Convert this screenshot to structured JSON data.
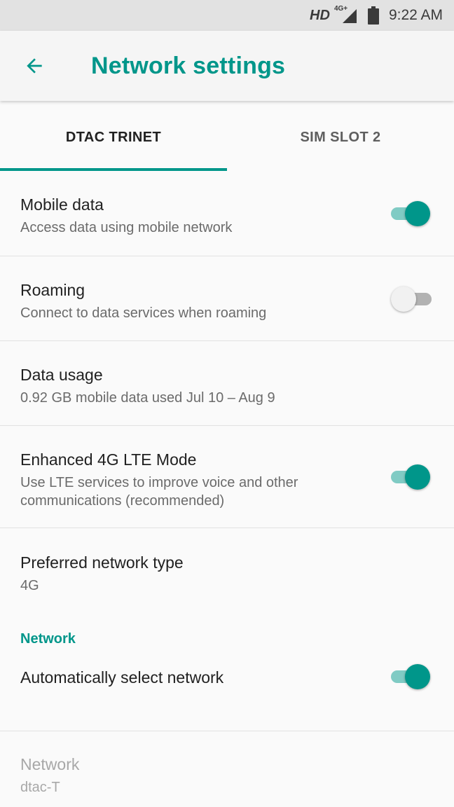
{
  "status_bar": {
    "hd": "HD",
    "network": "4G+",
    "time": "9:22 AM",
    "icons": [
      "signal-icon",
      "battery-icon"
    ]
  },
  "app_bar": {
    "title": "Network settings",
    "back_icon": "arrow-back-icon"
  },
  "tabs": [
    {
      "label": "DTAC TRINET",
      "active": true
    },
    {
      "label": "SIM SLOT 2",
      "active": false
    }
  ],
  "settings": {
    "mobile_data": {
      "title": "Mobile data",
      "summary": "Access data using mobile network",
      "enabled": true
    },
    "roaming": {
      "title": "Roaming",
      "summary": "Connect to data services when roaming",
      "enabled": false
    },
    "data_usage": {
      "title": "Data usage",
      "summary": "0.92 GB mobile data used Jul 10 – Aug 9"
    },
    "enhanced_lte": {
      "title": "Enhanced 4G LTE Mode",
      "summary_line1": "Use LTE services to improve voice and other",
      "summary_line2": "communications (recommended)",
      "enabled": true
    },
    "preferred_network": {
      "title": "Preferred network type",
      "summary": "4G"
    }
  },
  "network_section": {
    "header": "Network",
    "auto_select": {
      "title": "Automatically select network",
      "enabled": true
    },
    "network": {
      "title": "Network",
      "summary": "dtac-T",
      "disabled": true
    }
  },
  "colors": {
    "accent": "#00968a",
    "accent_track": "#80cbc4",
    "background": "#fafafa",
    "status_bar": "#e2e2e2"
  }
}
